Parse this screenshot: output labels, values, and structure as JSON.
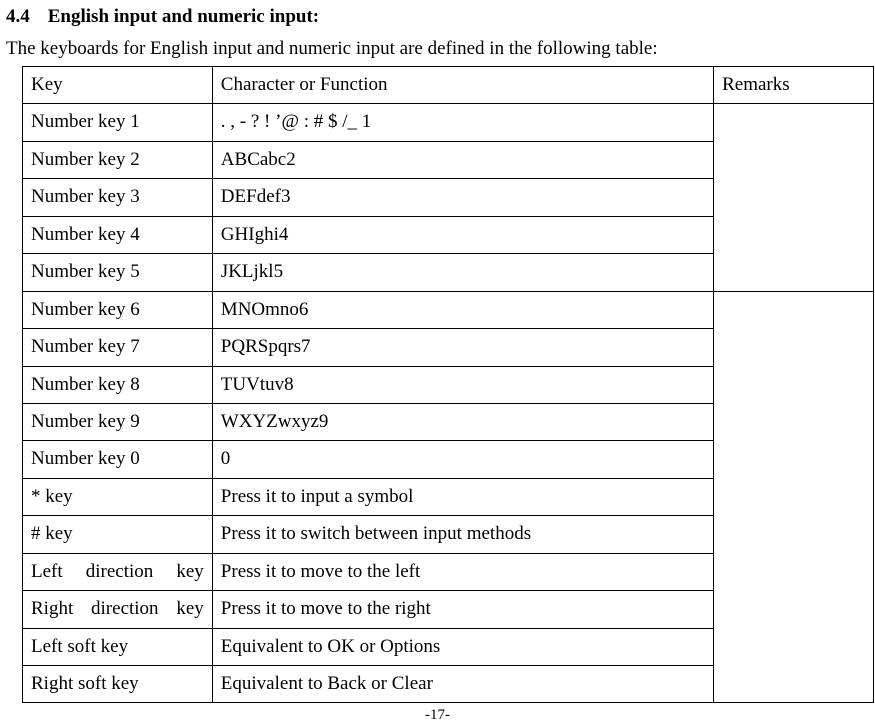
{
  "heading": {
    "number": "4.4",
    "title": "English input and numeric input:"
  },
  "intro": "The keyboards for English input and numeric input are defined in the following table:",
  "table": {
    "header": {
      "key": "Key",
      "char": "Character or Function",
      "remarks": "Remarks"
    },
    "rows": [
      {
        "key": "Number key 1",
        "char": ". , - ? ! ’@ : # $ /_ 1"
      },
      {
        "key": "Number key 2",
        "char": "ABCabc2"
      },
      {
        "key": "Number key 3",
        "char": "DEFdef3"
      },
      {
        "key": "Number key 4",
        "char": "GHIghi4"
      },
      {
        "key": "Number key 5",
        "char": "JKLjkl5"
      },
      {
        "key": "Number key 6",
        "char": "MNOmno6"
      },
      {
        "key": "Number key 7",
        "char": "PQRSpqrs7"
      },
      {
        "key": "Number key 8",
        "char": "TUVtuv8"
      },
      {
        "key": "Number key 9",
        "char": "WXYZwxyz9"
      },
      {
        "key": "Number key 0",
        "char": "0"
      },
      {
        "key": "* key",
        "char": "Press it to input a symbol"
      },
      {
        "key": "# key",
        "char": "Press it to switch between input methods"
      },
      {
        "key": "Left direction key",
        "char": "Press it to move to the left",
        "justifyKey": true
      },
      {
        "key": "Right direction key",
        "char": "Press it to move to the right",
        "justifyKey": true
      },
      {
        "key": "Left soft key",
        "char": "Equivalent to OK or Options"
      },
      {
        "key": "Right soft key",
        "char": "Equivalent to Back or Clear"
      }
    ]
  },
  "page_number": "-17-"
}
